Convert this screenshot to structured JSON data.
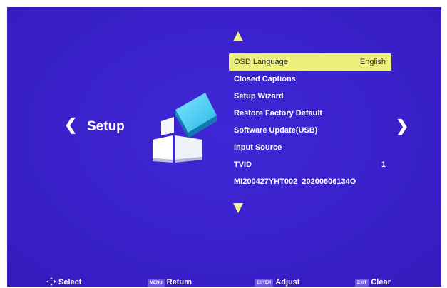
{
  "colors": {
    "background": "#3a21cc",
    "highlight": "#eef07e",
    "text": "#ffffff"
  },
  "page": {
    "title": "Setup",
    "left_nav_glyph": "❮",
    "right_nav_glyph": "❯",
    "icon": "setup-tiles-icon"
  },
  "menu": {
    "items": [
      {
        "label": "OSD Language",
        "value": "English",
        "selected": true
      },
      {
        "label": "Closed Captions",
        "value": ""
      },
      {
        "label": "Setup Wizard",
        "value": ""
      },
      {
        "label": "Restore Factory Default",
        "value": ""
      },
      {
        "label": "Software Update(USB)",
        "value": ""
      },
      {
        "label": "Input Source",
        "value": ""
      },
      {
        "label": "TVID",
        "value": "1"
      },
      {
        "label": "MI200427YHT002_20200606134O",
        "value": ""
      }
    ]
  },
  "footer": {
    "select": {
      "label": "Select",
      "icon": "dpad-icon"
    },
    "return": {
      "key": "MENU",
      "label": "Return"
    },
    "adjust": {
      "key": "ENTER",
      "label": "Adjust"
    },
    "clear": {
      "key": "EXIT",
      "label": "Clear"
    }
  }
}
